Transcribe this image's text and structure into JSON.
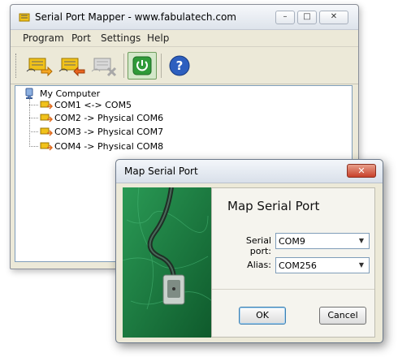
{
  "main_window": {
    "title": "Serial Port Mapper - www.fabulatech.com",
    "menu": [
      "Program",
      "Port",
      "Settings",
      "Help"
    ],
    "toolbar": [
      {
        "name": "add-mapping-button",
        "icon": "port-add-icon"
      },
      {
        "name": "remove-mapping-button",
        "icon": "port-remove-icon"
      },
      {
        "name": "disabled-mapping-button",
        "icon": "port-disabled-icon"
      },
      {
        "name": "power-button",
        "icon": "power-icon"
      },
      {
        "name": "help-button",
        "icon": "help-icon"
      }
    ],
    "tree": {
      "root": "My Computer",
      "items": [
        "COM1 <-> COM5",
        "COM2 -> Physical COM6",
        "COM3 -> Physical COM7",
        "COM4 -> Physical COM8"
      ]
    }
  },
  "dialog": {
    "title": "Map Serial Port",
    "heading": "Map Serial Port",
    "serial_port_label": "Serial port:",
    "serial_port_value": "COM9",
    "alias_label": "Alias:",
    "alias_value": "COM256",
    "ok_label": "OK",
    "cancel_label": "Cancel"
  },
  "colors": {
    "accent_green": "#2f9a39",
    "help_blue": "#2d5fbf",
    "port_icon_yellow": "#f1c21a",
    "dialog_image_green": "#1e7f3f"
  }
}
